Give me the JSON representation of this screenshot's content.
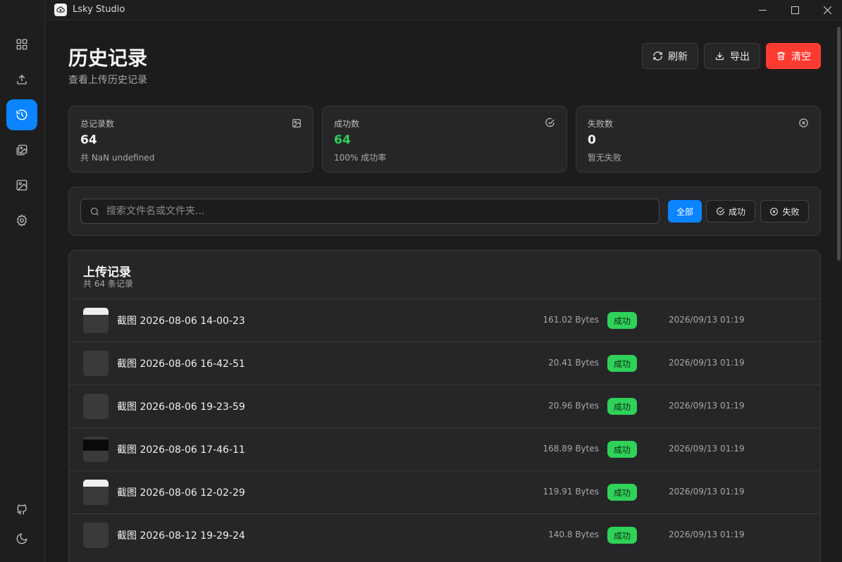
{
  "window": {
    "title": "Lsky Studio"
  },
  "page": {
    "title": "历史记录",
    "subtitle": "查看上传历史记录"
  },
  "actions": {
    "refresh": "刷新",
    "export": "导出",
    "clear": "清空"
  },
  "stats": {
    "total": {
      "label": "总记录数",
      "value": "64",
      "note": "共 NaN undefined"
    },
    "success": {
      "label": "成功数",
      "value": "64",
      "note": "100% 成功率"
    },
    "failed": {
      "label": "失败数",
      "value": "0",
      "note": "暂无失败"
    }
  },
  "filter": {
    "placeholder": "搜索文件名或文件夹...",
    "all": "全部",
    "success": "成功",
    "failed": "失败"
  },
  "records": {
    "title": "上传记录",
    "count_text": "共 64 条记录",
    "items": [
      {
        "name": "截图 2026-08-06 14-00-23",
        "size": "161.02 Bytes",
        "status": "成功",
        "time": "2026/09/13 01:19",
        "thumb": "light"
      },
      {
        "name": "截图 2026-08-06 16-42-51",
        "size": "20.41 Bytes",
        "status": "成功",
        "time": "2026/09/13 01:19",
        "thumb": "empty"
      },
      {
        "name": "截图 2026-08-06 19-23-59",
        "size": "20.96 Bytes",
        "status": "成功",
        "time": "2026/09/13 01:19",
        "thumb": "empty"
      },
      {
        "name": "截图 2026-08-06 17-46-11",
        "size": "168.89 Bytes",
        "status": "成功",
        "time": "2026/09/13 01:19",
        "thumb": "dark"
      },
      {
        "name": "截图 2026-08-06 12-02-29",
        "size": "119.91 Bytes",
        "status": "成功",
        "time": "2026/09/13 01:19",
        "thumb": "light"
      },
      {
        "name": "截图 2026-08-12 19-29-24",
        "size": "140.8 Bytes",
        "status": "成功",
        "time": "2026/09/13 01:19",
        "thumb": "empty"
      }
    ]
  },
  "colors": {
    "accent": "#0a84ff",
    "danger": "#ff3b30",
    "success": "#30d158"
  }
}
